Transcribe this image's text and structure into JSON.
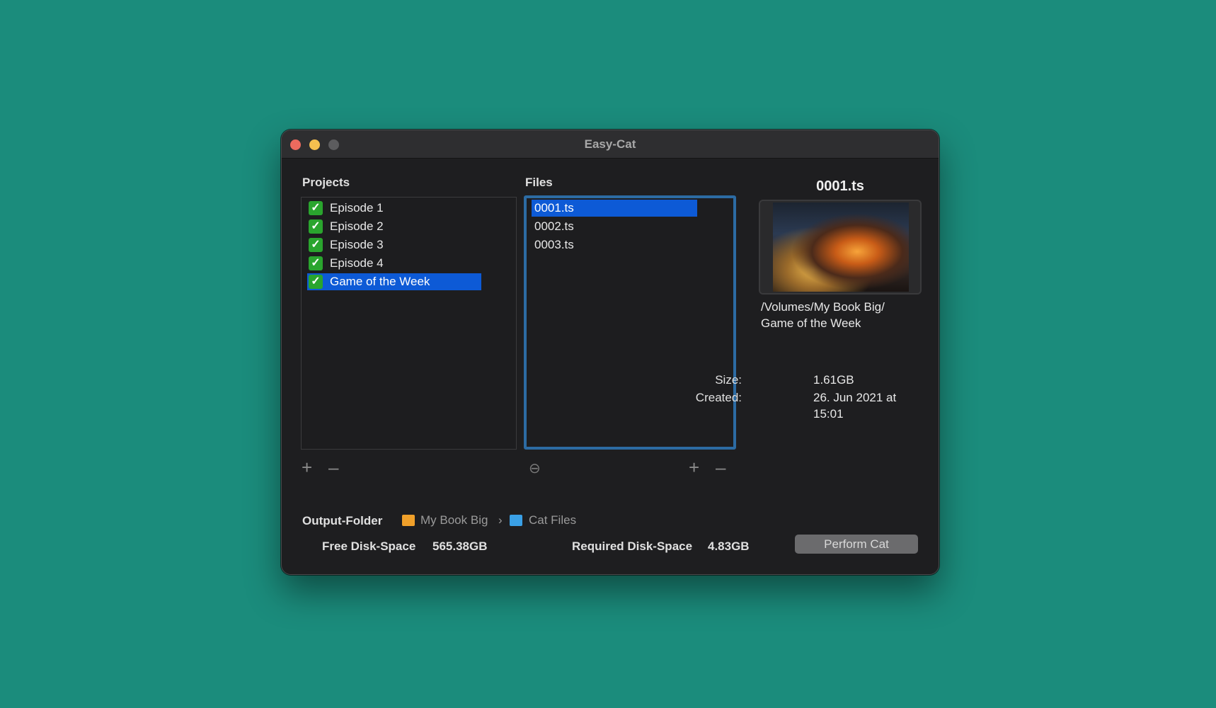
{
  "window": {
    "title": "Easy-Cat"
  },
  "projects": {
    "label": "Projects",
    "items": [
      {
        "label": "Episode 1",
        "checked": true,
        "selected": false
      },
      {
        "label": "Episode 2",
        "checked": true,
        "selected": false
      },
      {
        "label": "Episode 3",
        "checked": true,
        "selected": false
      },
      {
        "label": "Episode 4",
        "checked": true,
        "selected": false
      },
      {
        "label": "Game of the Week",
        "checked": true,
        "selected": true
      }
    ],
    "add_icon": "plus-icon",
    "remove_icon": "minus-icon"
  },
  "files": {
    "label": "Files",
    "items": [
      {
        "label": "0001.ts",
        "selected": true
      },
      {
        "label": "0002.ts",
        "selected": false
      },
      {
        "label": "0003.ts",
        "selected": false
      }
    ],
    "options_icon": "ellipsis-circle-icon",
    "add_icon": "plus-icon",
    "remove_icon": "minus-icon"
  },
  "preview": {
    "title": "0001.ts",
    "path_line1": "/Volumes/My Book Big/",
    "path_line2": "Game of the Week",
    "size_key": "Size:",
    "size_value": "1.61GB",
    "created_key": "Created:",
    "created_line1": "26. Jun 2021 at",
    "created_line2": "15:01"
  },
  "footer": {
    "output_label": "Output-Folder",
    "crumb_drive": "My Book Big",
    "crumb_sep": "›",
    "crumb_folder": "Cat Files",
    "free_label": "Free Disk-Space",
    "free_value": "565.38GB",
    "required_label": "Required Disk-Space",
    "required_value": "4.83GB",
    "perform_label": "Perform Cat"
  },
  "colors": {
    "background": "#1b8c7c",
    "selection": "#0d5ad6",
    "checkbox": "#2aa52e",
    "focus_ring": "#2c6ba3",
    "drive_icon": "#f0a02a",
    "folder_icon": "#3aa0e6"
  }
}
